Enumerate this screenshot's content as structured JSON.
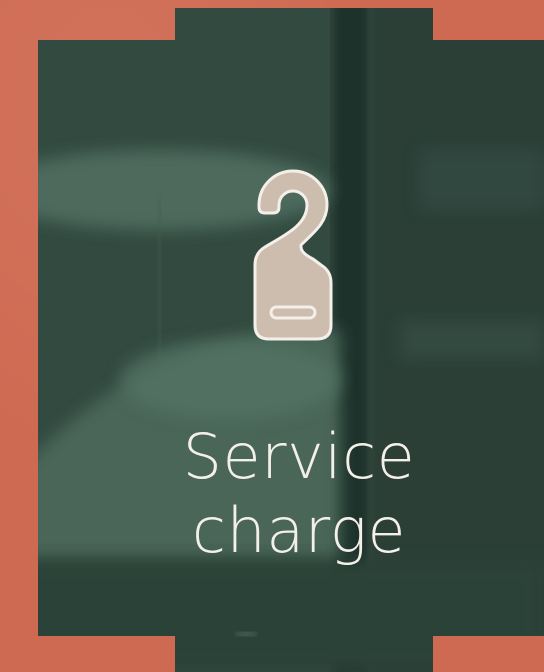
{
  "card": {
    "title_line1": "Service",
    "title_line2": "charge",
    "icon": "door-hanger-icon"
  },
  "colors": {
    "border": "#cf6a52",
    "panel": "#324a40",
    "icon_fill": "#cdbdaf",
    "icon_stroke": "#f4efe9",
    "text": "#f4efe9"
  }
}
